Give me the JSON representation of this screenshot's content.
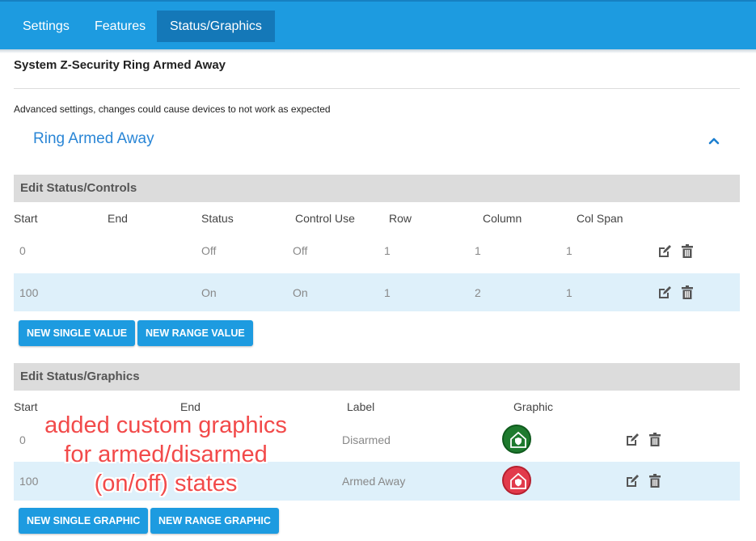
{
  "nav": {
    "tabs": [
      {
        "label": "Settings",
        "active": false
      },
      {
        "label": "Features",
        "active": false
      },
      {
        "label": "Status/Graphics",
        "active": true
      }
    ]
  },
  "page": {
    "system_title": "System Z-Security Ring Armed Away",
    "advanced_warning": "Advanced settings, changes could cause devices to not work as expected",
    "section_title": "Ring Armed Away"
  },
  "status_controls": {
    "heading": "Edit Status/Controls",
    "columns": [
      "Start",
      "End",
      "Status",
      "Control Use",
      "Row",
      "Column",
      "Col Span"
    ],
    "rows": [
      {
        "start": "0",
        "end": "",
        "status": "Off",
        "control_use": "Off",
        "row": "1",
        "column": "1",
        "col_span": "1"
      },
      {
        "start": "100",
        "end": "",
        "status": "On",
        "control_use": "On",
        "row": "1",
        "column": "2",
        "col_span": "1"
      }
    ],
    "buttons": {
      "new_single": "NEW SINGLE VALUE",
      "new_range": "NEW RANGE VALUE"
    }
  },
  "status_graphics": {
    "heading": "Edit Status/Graphics",
    "columns": [
      "Start",
      "End",
      "Label",
      "Graphic"
    ],
    "rows": [
      {
        "start": "0",
        "end": "",
        "label": "Disarmed",
        "graphic_icon": "house-shield-icon",
        "graphic_color": "#1e7a2e"
      },
      {
        "start": "100",
        "end": "",
        "label": "Armed Away",
        "graphic_icon": "house-shield-icon",
        "graphic_color": "#e23a4b"
      }
    ],
    "buttons": {
      "new_single": "NEW SINGLE GRAPHIC",
      "new_range": "NEW RANGE GRAPHIC"
    }
  },
  "annotation": {
    "lines": [
      "added custom graphics",
      "for armed/disarmed",
      "(on/off) states"
    ]
  },
  "colors": {
    "accent": "#1d9be0",
    "row_highlight": "#def0fa",
    "annotation": "#f24a4a"
  }
}
